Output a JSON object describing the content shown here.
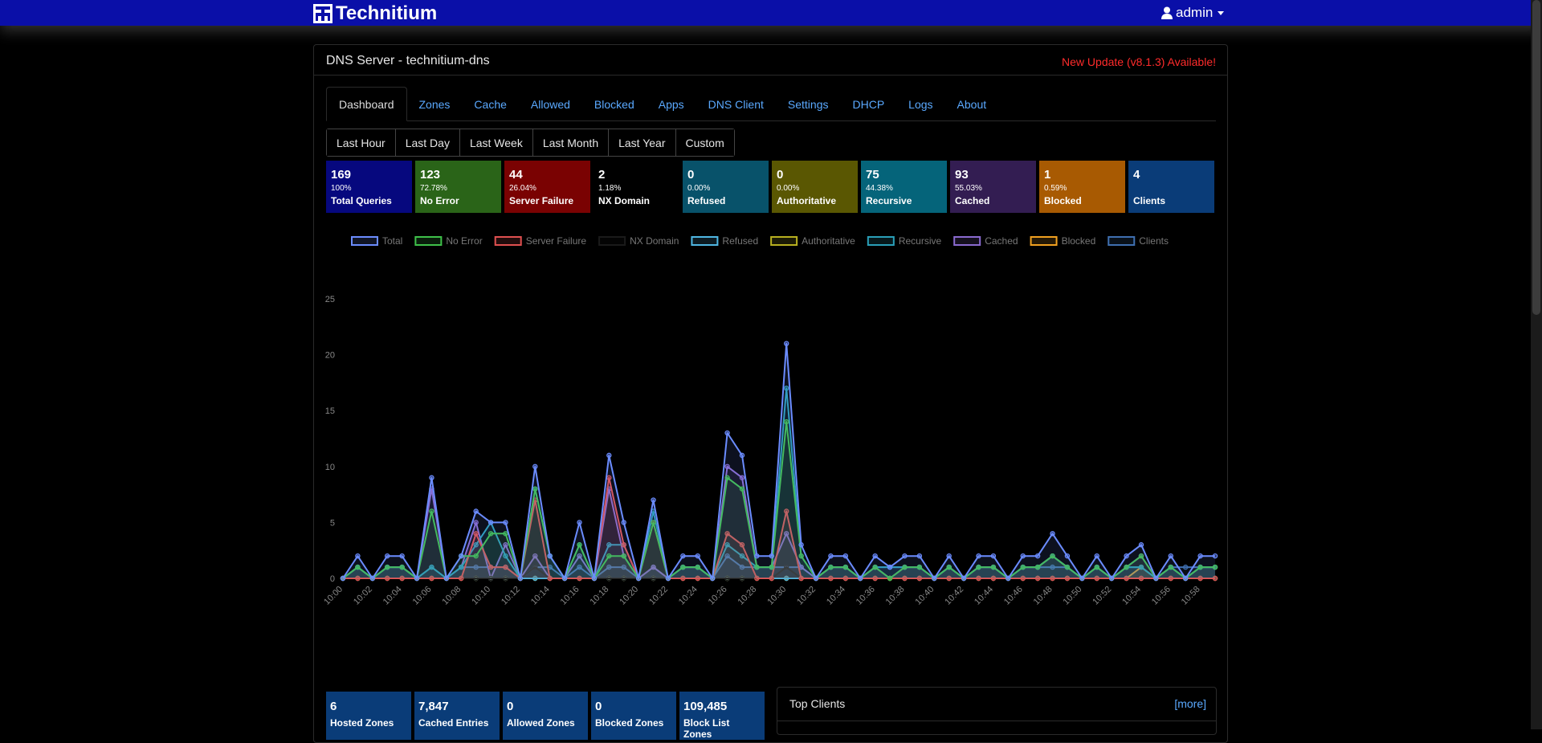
{
  "brand": {
    "name": "Technitium"
  },
  "user": {
    "name": "admin"
  },
  "panel": {
    "title": "DNS Server - technitium-dns",
    "update_notice": "New Update (v8.1.3) Available!"
  },
  "tabs": [
    {
      "label": "Dashboard",
      "active": true
    },
    {
      "label": "Zones"
    },
    {
      "label": "Cache"
    },
    {
      "label": "Allowed"
    },
    {
      "label": "Blocked"
    },
    {
      "label": "Apps"
    },
    {
      "label": "DNS Client"
    },
    {
      "label": "Settings"
    },
    {
      "label": "DHCP"
    },
    {
      "label": "Logs"
    },
    {
      "label": "About"
    }
  ],
  "ranges": [
    "Last Hour",
    "Last Day",
    "Last Week",
    "Last Month",
    "Last Year",
    "Custom"
  ],
  "stats": [
    {
      "value": "169",
      "percent": "100%",
      "label": "Total Queries",
      "color": "#06087e"
    },
    {
      "value": "123",
      "percent": "72.78%",
      "label": "No Error",
      "color": "#2a6418"
    },
    {
      "value": "44",
      "percent": "26.04%",
      "label": "Server Failure",
      "color": "#7a0202"
    },
    {
      "value": "2",
      "percent": "1.18%",
      "label": "NX Domain",
      "color": "#000000"
    },
    {
      "value": "0",
      "percent": "0.00%",
      "label": "Refused",
      "color": "#08526a"
    },
    {
      "value": "0",
      "percent": "0.00%",
      "label": "Authoritative",
      "color": "#5a5702"
    },
    {
      "value": "75",
      "percent": "44.38%",
      "label": "Recursive",
      "color": "#05647a"
    },
    {
      "value": "93",
      "percent": "55.03%",
      "label": "Cached",
      "color": "#331d52"
    },
    {
      "value": "1",
      "percent": "0.59%",
      "label": "Blocked",
      "color": "#a85a02"
    },
    {
      "value": "4",
      "percent": "",
      "label": "Clients",
      "color": "#0a3c78"
    }
  ],
  "chart_data": {
    "type": "line",
    "x": [
      "10:00",
      "10:01",
      "10:02",
      "10:03",
      "10:04",
      "10:05",
      "10:06",
      "10:07",
      "10:08",
      "10:09",
      "10:10",
      "10:11",
      "10:12",
      "10:13",
      "10:14",
      "10:15",
      "10:16",
      "10:17",
      "10:18",
      "10:19",
      "10:20",
      "10:21",
      "10:22",
      "10:23",
      "10:24",
      "10:25",
      "10:26",
      "10:27",
      "10:28",
      "10:29",
      "10:30",
      "10:31",
      "10:32",
      "10:33",
      "10:34",
      "10:35",
      "10:36",
      "10:37",
      "10:38",
      "10:39",
      "10:40",
      "10:41",
      "10:42",
      "10:43",
      "10:44",
      "10:45",
      "10:46",
      "10:47",
      "10:48",
      "10:49",
      "10:50",
      "10:51",
      "10:52",
      "10:53",
      "10:54",
      "10:55",
      "10:56",
      "10:57",
      "10:58",
      "10:59"
    ],
    "x_tick_labels": [
      "10:00",
      "10:02",
      "10:04",
      "10:06",
      "10:08",
      "10:10",
      "10:12",
      "10:14",
      "10:16",
      "10:18",
      "10:20",
      "10:22",
      "10:24",
      "10:26",
      "10:28",
      "10:30",
      "10:32",
      "10:34",
      "10:36",
      "10:38",
      "10:40",
      "10:42",
      "10:44",
      "10:46",
      "10:48",
      "10:50",
      "10:52",
      "10:54",
      "10:56",
      "10:58"
    ],
    "ylim": [
      0,
      25
    ],
    "y_ticks": [
      0,
      5,
      10,
      15,
      20,
      25
    ],
    "legend_position": "top",
    "series": [
      {
        "name": "Total",
        "color": "#6b8cff",
        "values": [
          0,
          2,
          0,
          2,
          2,
          0,
          9,
          0,
          2,
          6,
          5,
          5,
          0,
          10,
          2,
          0,
          5,
          0,
          11,
          5,
          0,
          7,
          0,
          2,
          2,
          0,
          13,
          11,
          2,
          2,
          21,
          3,
          0,
          2,
          2,
          0,
          2,
          1,
          2,
          2,
          0,
          2,
          0,
          2,
          2,
          0,
          2,
          2,
          4,
          2,
          0,
          2,
          0,
          2,
          3,
          0,
          2,
          0,
          2,
          2
        ]
      },
      {
        "name": "No Error",
        "color": "#3fc14a",
        "values": [
          0,
          1,
          0,
          1,
          1,
          0,
          6,
          0,
          2,
          2,
          4,
          4,
          0,
          8,
          2,
          0,
          3,
          0,
          2,
          2,
          0,
          5,
          0,
          1,
          1,
          0,
          9,
          8,
          1,
          1,
          14,
          2,
          0,
          1,
          1,
          0,
          1,
          0,
          1,
          1,
          0,
          1,
          0,
          1,
          1,
          0,
          1,
          1,
          2,
          1,
          0,
          1,
          0,
          1,
          2,
          0,
          1,
          0,
          1,
          1
        ]
      },
      {
        "name": "Server Failure",
        "color": "#e05050",
        "values": [
          0,
          0,
          0,
          0,
          0,
          0,
          0,
          0,
          0,
          4,
          1,
          1,
          0,
          7,
          0,
          0,
          0,
          0,
          9,
          3,
          0,
          5,
          0,
          0,
          0,
          0,
          4,
          3,
          0,
          0,
          6,
          0,
          0,
          0,
          0,
          0,
          0,
          0,
          0,
          0,
          0,
          0,
          0,
          0,
          0,
          0,
          0,
          0,
          0,
          0,
          0,
          0,
          0,
          0,
          0,
          0,
          0,
          0,
          0,
          0
        ]
      },
      {
        "name": "NX Domain",
        "color": "#1a1a1a",
        "values": [
          0,
          0,
          0,
          0,
          0,
          0,
          0,
          0,
          0,
          0,
          0,
          0,
          0,
          1,
          0,
          0,
          0,
          0,
          0,
          0,
          0,
          0,
          0,
          0,
          0,
          0,
          0,
          0,
          0,
          0,
          1,
          0,
          0,
          0,
          0,
          0,
          0,
          0,
          0,
          0,
          0,
          0,
          0,
          0,
          0,
          0,
          0,
          0,
          0,
          0,
          0,
          0,
          0,
          0,
          0,
          0,
          0,
          0,
          0,
          0
        ]
      },
      {
        "name": "Refused",
        "color": "#4fb7e3",
        "values": [
          0,
          0,
          0,
          0,
          0,
          0,
          0,
          0,
          0,
          0,
          0,
          0,
          0,
          0,
          0,
          0,
          0,
          0,
          0,
          0,
          0,
          0,
          0,
          0,
          0,
          0,
          0,
          0,
          0,
          0,
          0,
          0,
          0,
          0,
          0,
          0,
          0,
          0,
          0,
          0,
          0,
          0,
          0,
          0,
          0,
          0,
          0,
          0,
          0,
          0,
          0,
          0,
          0,
          0,
          0,
          0,
          0,
          0,
          0,
          0
        ]
      },
      {
        "name": "Authoritative",
        "color": "#b8b020",
        "values": [
          0,
          0,
          0,
          0,
          0,
          0,
          0,
          0,
          0,
          0,
          0,
          0,
          0,
          0,
          0,
          0,
          0,
          0,
          0,
          0,
          0,
          0,
          0,
          0,
          0,
          0,
          0,
          0,
          0,
          0,
          0,
          0,
          0,
          0,
          0,
          0,
          0,
          0,
          0,
          0,
          0,
          0,
          0,
          0,
          0,
          0,
          0,
          0,
          0,
          0,
          0,
          0,
          0,
          0,
          0,
          0,
          0,
          0,
          0,
          0
        ]
      },
      {
        "name": "Recursive",
        "color": "#2a9fb8",
        "values": [
          0,
          1,
          0,
          1,
          1,
          0,
          1,
          0,
          1,
          3,
          5,
          2,
          0,
          8,
          2,
          0,
          3,
          0,
          3,
          3,
          0,
          6,
          0,
          1,
          1,
          0,
          3,
          2,
          1,
          1,
          17,
          2,
          0,
          1,
          1,
          0,
          1,
          1,
          1,
          1,
          0,
          1,
          0,
          1,
          1,
          0,
          1,
          1,
          2,
          1,
          0,
          1,
          0,
          1,
          1,
          0,
          1,
          0,
          1,
          1
        ]
      },
      {
        "name": "Cached",
        "color": "#8a6ad0",
        "values": [
          0,
          1,
          0,
          1,
          1,
          0,
          8,
          0,
          1,
          5,
          0,
          3,
          0,
          2,
          0,
          0,
          2,
          0,
          8,
          2,
          0,
          1,
          0,
          1,
          1,
          0,
          10,
          9,
          1,
          1,
          4,
          1,
          0,
          1,
          1,
          0,
          1,
          0,
          1,
          1,
          0,
          1,
          0,
          1,
          1,
          0,
          1,
          1,
          2,
          1,
          0,
          1,
          0,
          1,
          2,
          0,
          1,
          0,
          1,
          1
        ]
      },
      {
        "name": "Blocked",
        "color": "#f0a020",
        "values": [
          0,
          0,
          0,
          0,
          0,
          0,
          0,
          0,
          0,
          0,
          0,
          0,
          0,
          0,
          0,
          0,
          0,
          0,
          0,
          0,
          0,
          0,
          0,
          0,
          0,
          0,
          0,
          0,
          0,
          0,
          0,
          0,
          0,
          0,
          0,
          0,
          0,
          0,
          0,
          0,
          0,
          0,
          0,
          0,
          0,
          0,
          0,
          0,
          0,
          0,
          0,
          0,
          0,
          0,
          1,
          0,
          0,
          0,
          0,
          0
        ]
      },
      {
        "name": "Clients",
        "color": "#3f6fb0",
        "values": [
          0,
          1,
          0,
          1,
          1,
          0,
          1,
          0,
          1,
          1,
          1,
          1,
          0,
          1,
          1,
          0,
          1,
          0,
          1,
          1,
          0,
          1,
          0,
          1,
          1,
          0,
          2,
          1,
          1,
          1,
          1,
          1,
          0,
          1,
          1,
          0,
          1,
          1,
          1,
          1,
          0,
          1,
          0,
          1,
          1,
          0,
          1,
          1,
          1,
          1,
          0,
          1,
          0,
          1,
          1,
          0,
          1,
          1,
          1,
          1
        ]
      }
    ]
  },
  "bottom_stats": [
    {
      "value": "6",
      "label": "Hosted Zones"
    },
    {
      "value": "7,847",
      "label": "Cached Entries"
    },
    {
      "value": "0",
      "label": "Allowed Zones"
    },
    {
      "value": "0",
      "label": "Blocked Zones"
    },
    {
      "value": "109,485",
      "label": "Block List Zones"
    }
  ],
  "top_clients": {
    "title": "Top Clients",
    "more": "[more]"
  }
}
